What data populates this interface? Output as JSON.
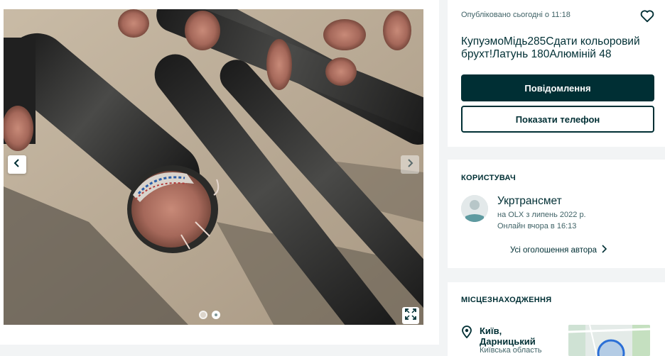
{
  "gallery": {
    "photo_alt": "",
    "slides_total": 2,
    "active_slide": 2
  },
  "listing": {
    "posted": "Опубліковано сьогодні о 11:18",
    "title": "КупуэмоМідь285Сдати кольоровий брухт!Латунь 180Алюміній 48",
    "message_button": "Повідомлення",
    "phone_button": "Показати телефон"
  },
  "user": {
    "heading": "КОРИСТУВАЧ",
    "name": "Укртрансмет",
    "since": "на OLX з липень 2022 р.",
    "online": "Онлайн вчора в 16:13",
    "all_ads": "Усі оголошення автора"
  },
  "location": {
    "heading": "МІСЦЕЗНАХОДЖЕННЯ",
    "city_line1": "Київ,",
    "city_line2": "Дарницький",
    "region": "Київська область"
  },
  "colors": {
    "brand_dark": "#002f34",
    "muted_text": "#406367",
    "background": "#f2f4f5"
  },
  "icons": {
    "favorite": "heart-icon",
    "prev": "chevron-left-icon",
    "next": "chevron-right-icon",
    "fullscreen": "expand-icon",
    "location": "map-pin-icon"
  }
}
